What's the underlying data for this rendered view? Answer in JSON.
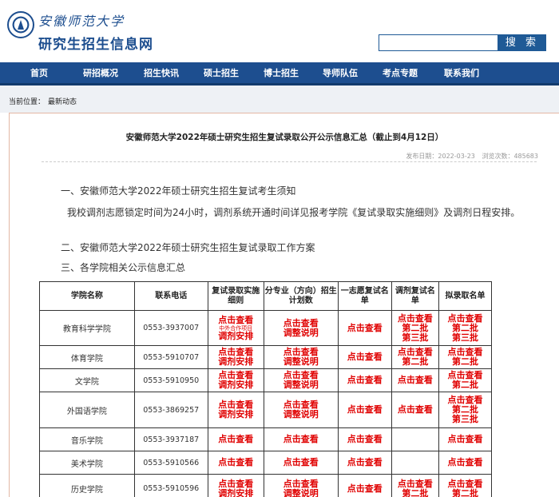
{
  "header": {
    "school_name": "安徽师范大学",
    "site_name": "研究生招生信息网",
    "search_placeholder": "",
    "search_button": "搜 索"
  },
  "nav": [
    "首页",
    "研招概况",
    "招生快讯",
    "硕士招生",
    "博士招生",
    "导师队伍",
    "考点专题",
    "联系我们"
  ],
  "breadcrumb": {
    "label": "当前位置：",
    "current": "最新动态"
  },
  "article": {
    "title": "安徽师范大学2022年硕士研究生招生复试录取公开公示信息汇总（截止到4月12日）",
    "date": "发布日期：2022-03-23",
    "views": "浏览次数：485683",
    "h1": "一、安徽师范大学2022年硕士研究生招生复试考生须知",
    "p1": "我校调剂志愿锁定时间为24小时，调剂系统开通时间详见报考学院《复试录取实施细则》及调剂日程安排。",
    "h2": "二、安徽师范大学2022年硕士研究生招生复试录取工作方案",
    "h3": "三、各学院相关公示信息汇总"
  },
  "table": {
    "headers": [
      "学院名称",
      "联系电话",
      "复试录取实施细则",
      "分专业（方向）招生计划数",
      "一志愿复试名单",
      "调剂复试名单",
      "拟录取名单"
    ],
    "rows": [
      {
        "name": "教育科学学院",
        "phone": "0553-3937007",
        "c3": [
          "点击查看",
          "中外合作项目",
          "调剂安排"
        ],
        "c4": [
          "点击查看",
          "调整说明"
        ],
        "c5": [
          "点击查看"
        ],
        "c6": [
          "点击查看",
          "第二批",
          "第三批"
        ],
        "c7": [
          "点击查看",
          "第二批",
          "第三批"
        ]
      },
      {
        "name": "体育学院",
        "phone": "0553-5910707",
        "c3": [
          "点击查看",
          "调剂安排"
        ],
        "c4": [
          "点击查看",
          "调整说明"
        ],
        "c5": [
          "点击查看"
        ],
        "c6": [
          "点击查看",
          "第二批"
        ],
        "c7": [
          "点击查看",
          "第二批"
        ]
      },
      {
        "name": "文学院",
        "phone": "0553-5910950",
        "c3": [
          "点击查看",
          "调剂安排"
        ],
        "c4": [
          "点击查看",
          "调整说明"
        ],
        "c5": [
          "点击查看"
        ],
        "c6": [
          "点击查看"
        ],
        "c7": [
          "点击查看",
          "第二批"
        ]
      },
      {
        "name": "外国语学院",
        "phone": "0553-3869257",
        "c3": [
          "点击查看",
          "调剂安排"
        ],
        "c4": [
          "点击查看",
          "调整说明"
        ],
        "c5": [
          "点击查看"
        ],
        "c6": [
          "点击查看"
        ],
        "c7": [
          "点击查看",
          "第二批",
          "第三批"
        ]
      },
      {
        "name": "音乐学院",
        "phone": "0553-3937187",
        "c3": [
          "点击查看"
        ],
        "c4": [
          "点击查看"
        ],
        "c5": [
          "点击查看"
        ],
        "c6": [],
        "c7": [
          "点击查看"
        ]
      },
      {
        "name": "美术学院",
        "phone": "0553-5910566",
        "c3": [
          "点击查看"
        ],
        "c4": [
          "点击查看"
        ],
        "c5": [
          "点击查看"
        ],
        "c6": [],
        "c7": [
          "点击查看"
        ]
      },
      {
        "name": "历史学院",
        "phone": "0553-5910596",
        "c3": [
          "点击查看",
          "调剂安排"
        ],
        "c4": [
          "点击查看",
          "调整说明"
        ],
        "c5": [
          "点击查看"
        ],
        "c6": [
          "点击查看",
          "第二批"
        ],
        "c7": [
          "点击查看",
          "第二批"
        ]
      }
    ]
  }
}
